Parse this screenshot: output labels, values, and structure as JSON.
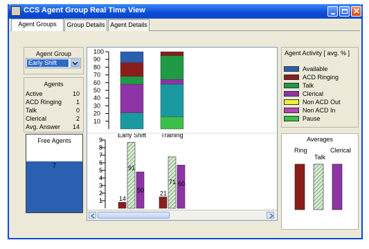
{
  "window": {
    "title": "CCS Agent Group Real Time View"
  },
  "tabs": [
    {
      "label": "Agent Groups",
      "active": true
    },
    {
      "label": "Group Details",
      "active": false
    },
    {
      "label": "Agent Details",
      "active": false
    }
  ],
  "agent_group": {
    "heading": "Agent Group",
    "selected": "Early Shift"
  },
  "agents": {
    "heading": "Agents",
    "rows": [
      {
        "label": "Active",
        "value": "10"
      },
      {
        "label": "ACD Ringing",
        "value": "1"
      },
      {
        "label": "Talk",
        "value": "0"
      },
      {
        "label": "Clerical",
        "value": "2"
      },
      {
        "label": "Avg. Answer",
        "value": "14"
      }
    ]
  },
  "free_agents": {
    "heading": "Free Agents",
    "value": "7"
  },
  "activity_legend": {
    "heading": "Agent Activity [ avg. % ]",
    "items": [
      {
        "label": "Available",
        "color": "#2b5fb0"
      },
      {
        "label": "ACD Ringing",
        "color": "#8b1d1d"
      },
      {
        "label": "Talk",
        "color": "#1f9a45"
      },
      {
        "label": "Clerical",
        "color": "#8e34a6"
      },
      {
        "label": "Non ACD Out",
        "color": "#f2ef3a"
      },
      {
        "label": "Non ACD In",
        "color": "#b348b0"
      },
      {
        "label": "Pause",
        "color": "#3cbf4a"
      }
    ]
  },
  "averages": {
    "heading": "Averages",
    "labels": [
      "Ring",
      "Talk",
      "Clerical"
    ]
  },
  "chart_data": [
    {
      "type": "bar",
      "stacked": true,
      "categories": [
        "Early Shift",
        "Training"
      ],
      "ylim": [
        0,
        100
      ],
      "yticks": [
        "100",
        "90",
        "80",
        "70",
        "60",
        "50",
        "40",
        "30",
        "20",
        "10"
      ],
      "series": [
        {
          "name": "Pause",
          "color": "#3cbf4a",
          "values": [
            0,
            16
          ]
        },
        {
          "name": "Non ACD In",
          "color": "#1a9aa0",
          "values": [
            21,
            42
          ]
        },
        {
          "name": "Clerical",
          "color": "#8e34a6",
          "values": [
            37,
            6
          ]
        },
        {
          "name": "Talk",
          "color": "#1f9a45",
          "values": [
            10,
            31
          ]
        },
        {
          "name": "ACD Ringing",
          "color": "#8b1d1d",
          "values": [
            18,
            5
          ]
        },
        {
          "name": "Available",
          "color": "#2b5fb0",
          "values": [
            14,
            0
          ]
        }
      ]
    },
    {
      "type": "bar",
      "categories": [
        "Early Shift",
        "Training"
      ],
      "ylim": [
        0,
        9
      ],
      "yticks": [
        "9",
        "8",
        "7",
        "6",
        "5",
        "4",
        "3",
        "2",
        "1"
      ],
      "series": [
        {
          "name": "Ring",
          "color": "#8b1d1d",
          "values": [
            14,
            21
          ],
          "heights": [
            0.8,
            1.5
          ]
        },
        {
          "name": "Talk",
          "color": "#d8ead2",
          "hatched": true,
          "values": [
            91,
            71
          ],
          "heights": [
            8.7,
            6.8
          ]
        },
        {
          "name": "Clerical",
          "color": "#8e34a6",
          "values": [
            50,
            60
          ],
          "heights": [
            4.8,
            5.7
          ]
        }
      ]
    }
  ]
}
